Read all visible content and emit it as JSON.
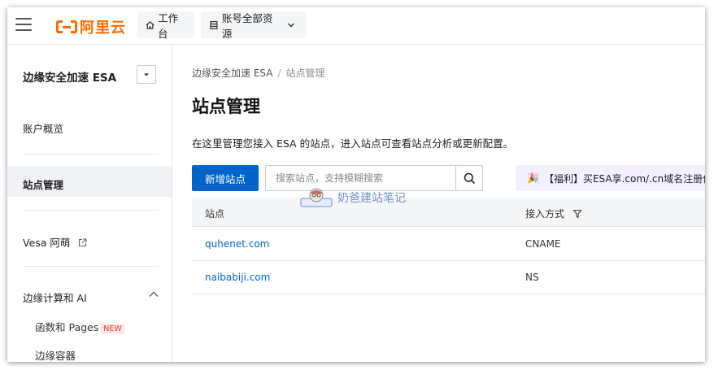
{
  "brand": {
    "name": "阿里云",
    "color": "#ff6a00"
  },
  "topbar": {
    "workbench_label": "工作台",
    "resources_label": "账号全部资源"
  },
  "sidebar": {
    "product": "边缘安全加速 ESA",
    "items": [
      {
        "label": "账户概览"
      },
      {
        "label": "站点管理",
        "active": true
      },
      {
        "label": "Vesa 阿萌"
      },
      {
        "label": "边缘计算和 AI"
      }
    ],
    "sub_items": [
      {
        "label": "函数和 Pages",
        "badge": "NEW"
      },
      {
        "label": "边缘容器"
      }
    ]
  },
  "breadcrumb": {
    "root": "边缘安全加速 ESA",
    "current": "站点管理"
  },
  "page": {
    "title": "站点管理",
    "description": "在这里管理您接入 ESA 的站点，进入站点可查看站点分析或更新配置。",
    "add_button": "新增站点",
    "search_placeholder": "搜索站点，支持模糊搜索",
    "promo": "【福利】买ESA享.com/.cn域名注册优"
  },
  "table": {
    "columns": [
      "站点",
      "接入方式"
    ],
    "rows": [
      {
        "site": "quhenet.com",
        "access": "CNAME"
      },
      {
        "site": "naibabiji.com",
        "access": "NS"
      }
    ]
  },
  "watermark": {
    "text": "奶爸建站笔记"
  },
  "colors": {
    "primary": "#0064c8",
    "accent": "#ff6a00"
  }
}
